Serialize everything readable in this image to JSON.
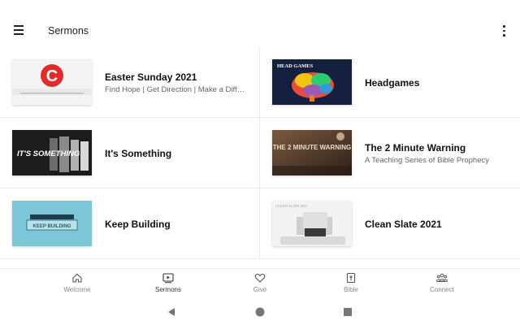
{
  "header": {
    "title": "Sermons",
    "menu_icon": "hamburger-icon",
    "overflow_icon": "more-vert-icon"
  },
  "sermons": [
    {
      "title": "Easter Sunday 2021",
      "subtitle": "Find Hope | Get Direction | Make a Differ...",
      "thumb_text": "C"
    },
    {
      "title": "Headgames",
      "subtitle": "",
      "thumb_text": "HEAD GAMES"
    },
    {
      "title": "It's Something",
      "subtitle": "",
      "thumb_text": "IT'S SOMETHING"
    },
    {
      "title": "The 2 Minute Warning",
      "subtitle": "A Teaching Series of Bible Prophecy",
      "thumb_text": "THE 2 MINUTE WARNING"
    },
    {
      "title": "Keep Building",
      "subtitle": "",
      "thumb_text": "KEEP BUILDING"
    },
    {
      "title": "Clean Slate 2021",
      "subtitle": "",
      "thumb_text": "CLEAN SLATE 2021"
    }
  ],
  "nav": [
    {
      "label": "Welcome",
      "icon": "home-icon"
    },
    {
      "label": "Sermons",
      "icon": "video-play-icon",
      "active": true
    },
    {
      "label": "Give",
      "icon": "heart-icon"
    },
    {
      "label": "Bible",
      "icon": "bible-icon"
    },
    {
      "label": "Connect",
      "icon": "people-icon"
    }
  ],
  "system_nav": {
    "back": "back-icon",
    "home": "home-circle-icon",
    "recents": "recents-icon"
  },
  "colors": {
    "accent_red": "#e32a2a",
    "dark_brown": "#4a3426",
    "teal": "#5fb3c9"
  }
}
